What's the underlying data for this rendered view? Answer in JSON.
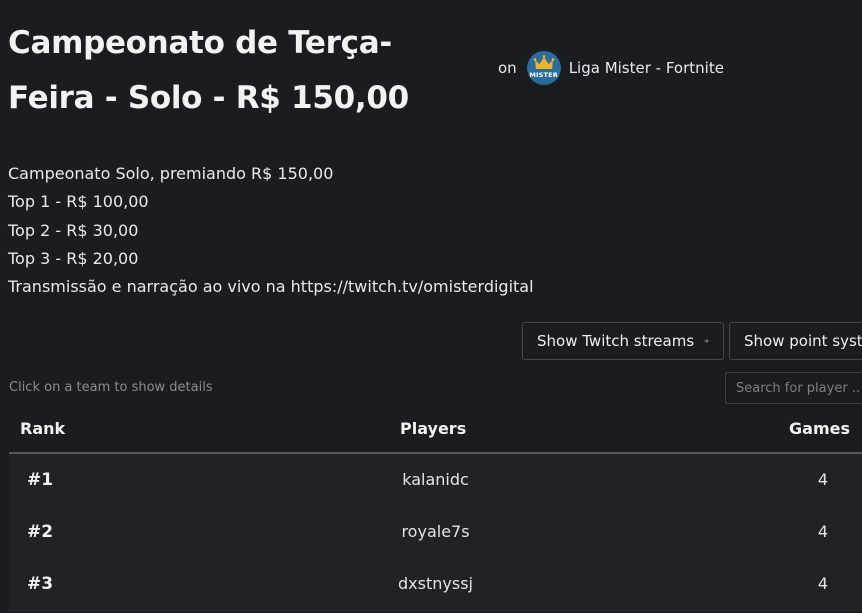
{
  "header": {
    "title": "Campeonato de Terça-Feira - Solo - R$ 150,00",
    "on_label": "on",
    "organizer": "Liga Mister - Fortnite",
    "logo_text": "MISTER"
  },
  "description": {
    "lines": [
      "Campeonato Solo, premiando R$ 150,00",
      "Top 1 - R$ 100,00",
      "Top 2 - R$ 30,00",
      "Top 3 - R$ 20,00",
      "Transmissão e narração ao vivo na https://twitch.tv/omisterdigital"
    ]
  },
  "actions": {
    "twitch_label": "Show Twitch streams",
    "points_label": "Show point system"
  },
  "table": {
    "hint": "Click on a team to show details",
    "search_placeholder": "Search for player ...",
    "headers": {
      "rank": "Rank",
      "players": "Players",
      "games": "Games"
    },
    "rows": [
      {
        "rank": "#1",
        "player": "kalanidc",
        "games": "4"
      },
      {
        "rank": "#2",
        "player": "royale7s",
        "games": "4"
      },
      {
        "rank": "#3",
        "player": "dxstnyssj",
        "games": "4"
      }
    ]
  },
  "colors": {
    "background": "#1b1c20",
    "row_background": "#212226",
    "logo_blue": "#2a6c9a",
    "crown_gold": "#f0b429"
  },
  "icons": {
    "arrow": "arrow-right-icon",
    "logo": "liga-mister-logo"
  }
}
